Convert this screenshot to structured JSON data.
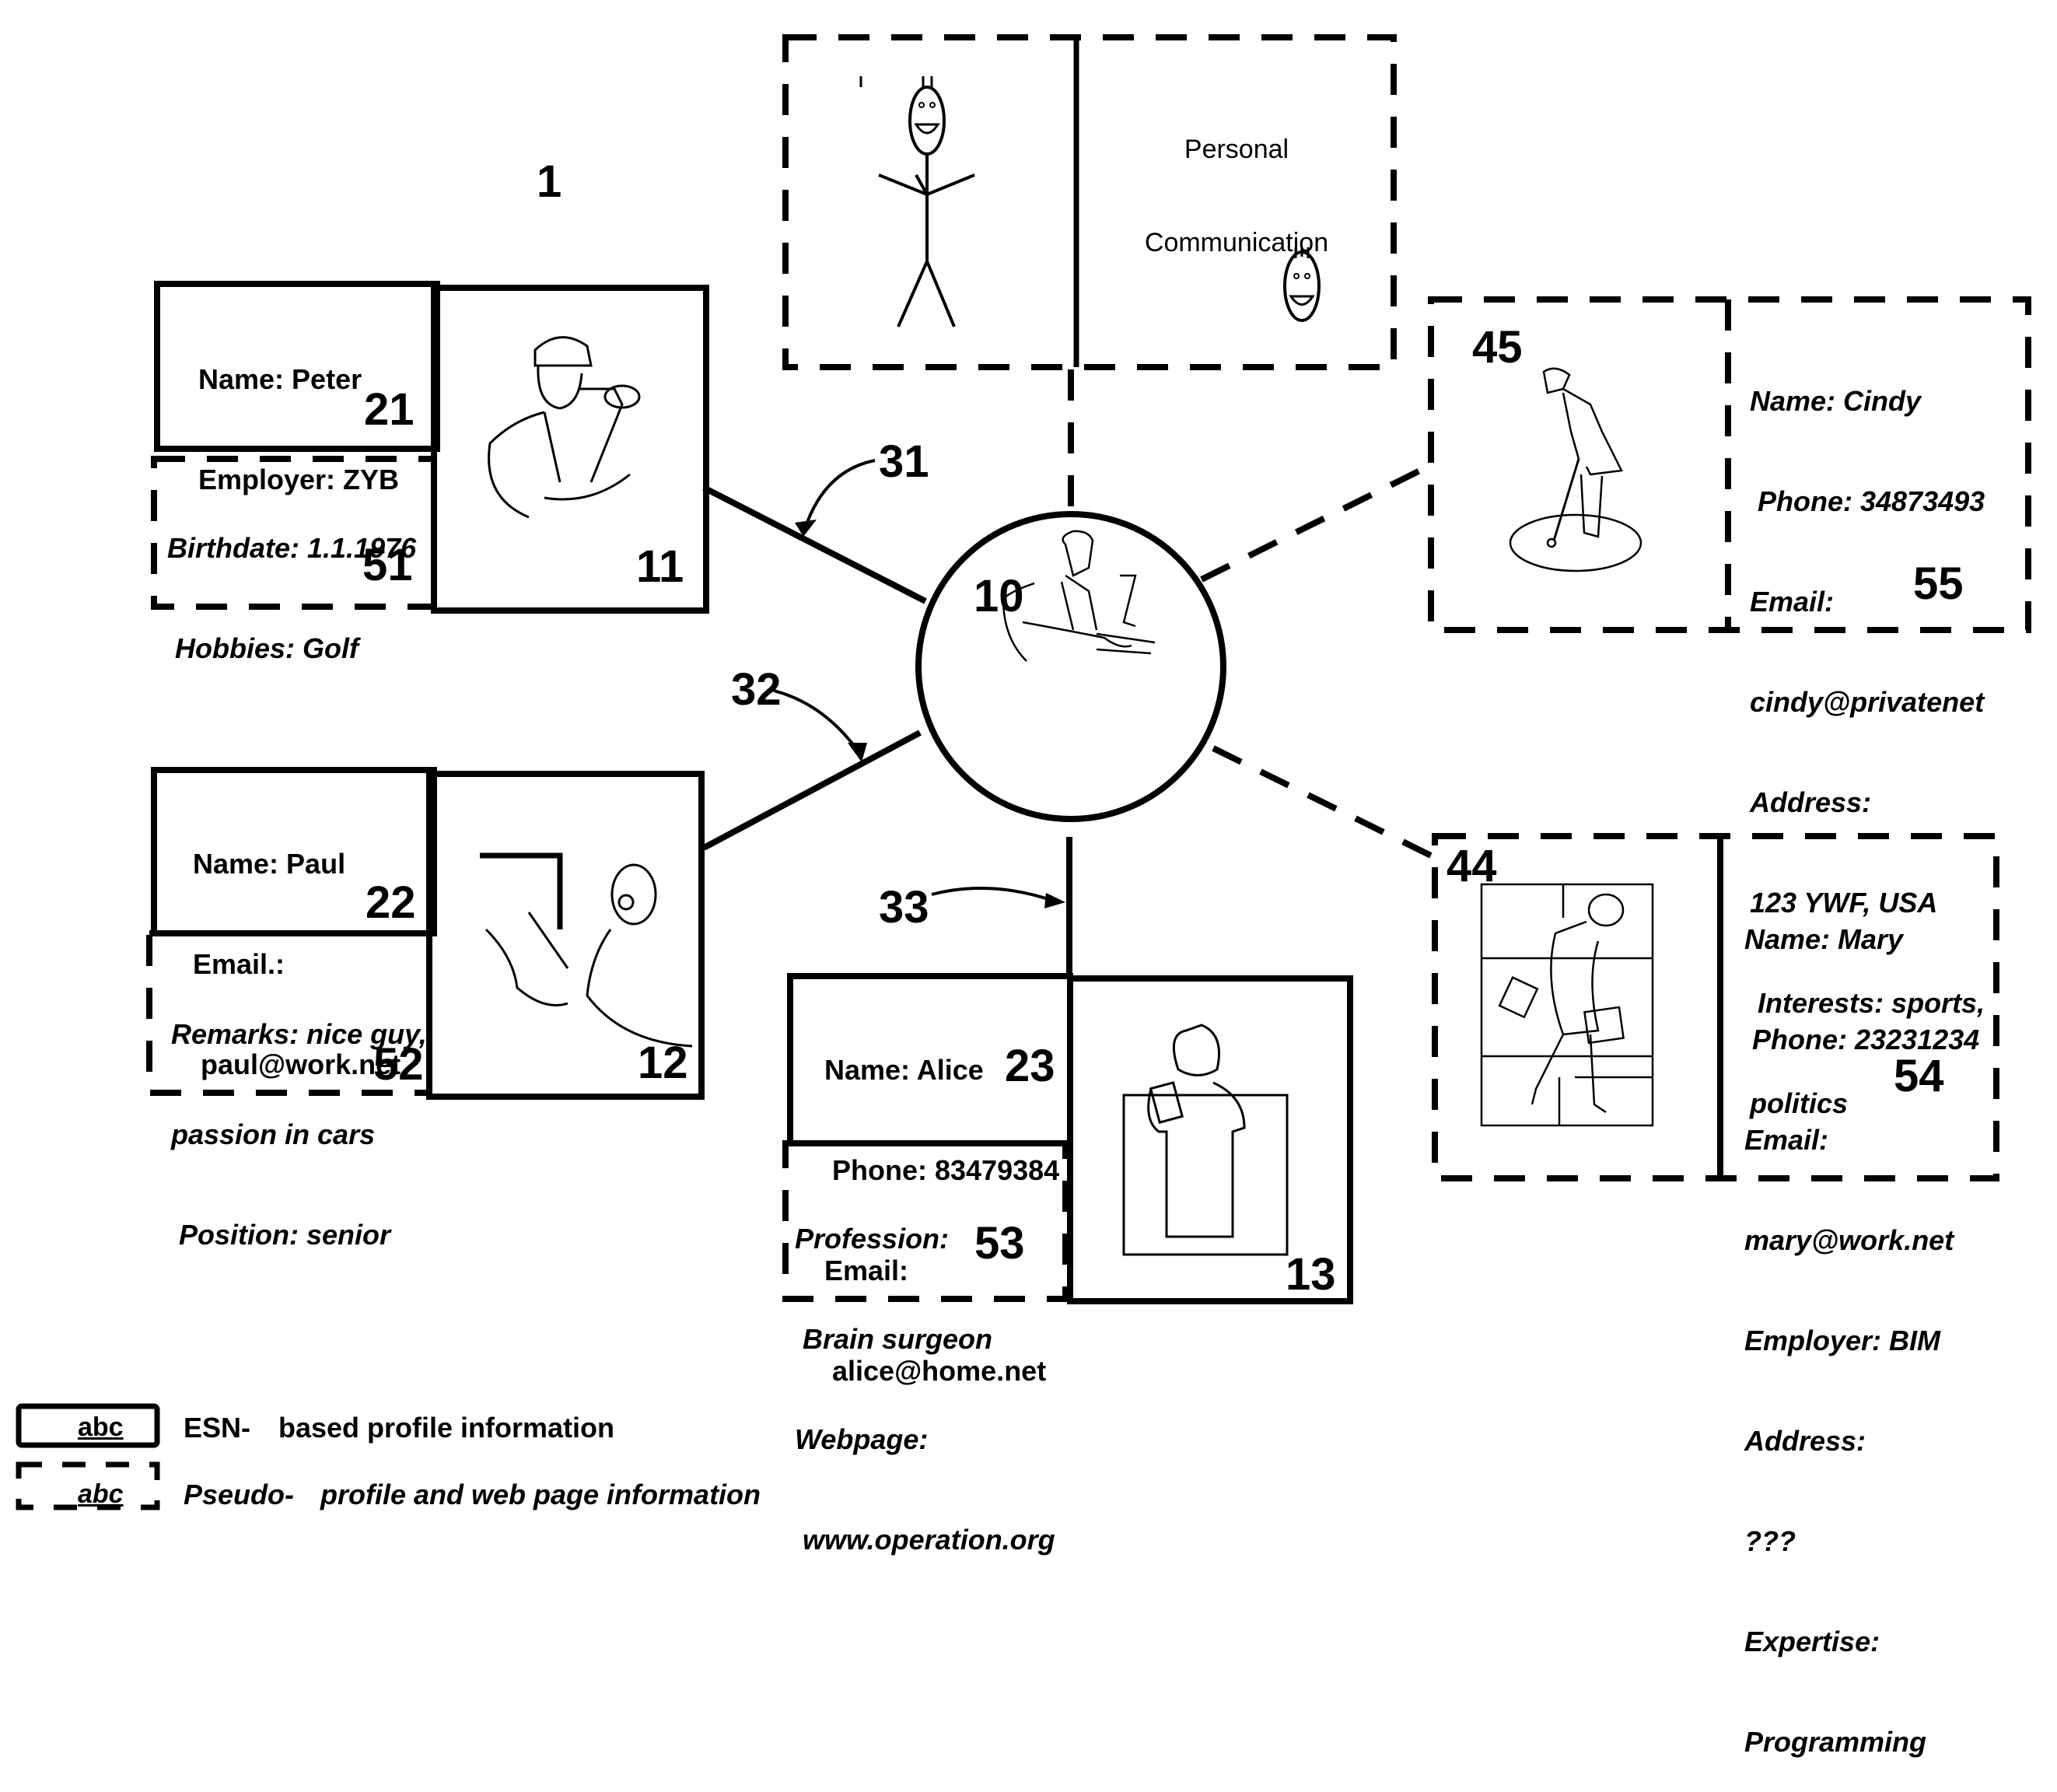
{
  "figure": {
    "figure_ref": "1",
    "center_node": {
      "ref": "10",
      "icon": "person-at-computer-icon"
    },
    "connectors": [
      {
        "ref": "31",
        "to": "11",
        "style": "solid"
      },
      {
        "ref": "32",
        "to": "12",
        "style": "solid"
      },
      {
        "ref": "33",
        "to": "13",
        "style": "solid"
      }
    ],
    "personal_communication": {
      "label_line1": "Personal",
      "label_line2": "Communication",
      "icons": [
        "stick-figure-icon",
        "smiley-face-icon"
      ]
    },
    "contacts": [
      {
        "image_ref": "11",
        "image_icon": "woman-with-hardhat-blueprints-icon",
        "esn": {
          "ref": "21",
          "lines": [
            "Name: Peter",
            "Employer: ZYB"
          ]
        },
        "pseudo": {
          "ref": "51",
          "lines": [
            "Birthdate: 1.1.1976",
            " Hobbies: Golf"
          ]
        }
      },
      {
        "image_ref": "12",
        "image_icon": "presenter-with-pointer-icon",
        "esn": {
          "ref": "22",
          "lines": [
            "Name: Paul",
            "Email.:",
            " paul@work.net"
          ]
        },
        "pseudo": {
          "ref": "52",
          "lines": [
            "Remarks: nice guy,",
            "passion in cars",
            " Position: senior"
          ]
        }
      },
      {
        "image_ref": "13",
        "image_icon": "doctor-with-clipboard-icon",
        "esn": {
          "ref": "23",
          "lines": [
            "Name: Alice",
            " Phone: 83479384",
            "Email:",
            " alice@home.net"
          ]
        },
        "pseudo": {
          "ref": "53",
          "lines": [
            "Profession:",
            " Brain surgeon",
            "Webpage:",
            " www.operation.org"
          ]
        }
      },
      {
        "image_ref": "45",
        "image_icon": "woman-golfer-icon",
        "pseudo": {
          "ref": "55",
          "lines": [
            "Name: Cindy",
            " Phone: 34873493",
            "Email:",
            "cindy@privatenet",
            "Address:",
            "123 YWF, USA",
            " Interests: sports,",
            "politics"
          ]
        }
      },
      {
        "image_ref": "44",
        "image_icon": "businesswoman-with-briefcase-icon",
        "pseudo": {
          "ref": "54",
          "lines": [
            "Name: Mary",
            " Phone: 23231234",
            "Email:",
            "mary@work.net",
            "Employer: BIM",
            "Address:",
            "???",
            "Expertise:",
            "Programming"
          ]
        }
      }
    ]
  },
  "legend": {
    "items": [
      {
        "sample": "abc",
        "style": "solid",
        "prefix": "ESN-",
        "text": "based profile information"
      },
      {
        "sample": "abc",
        "style": "dashed",
        "prefix": "Pseudo-",
        "text": "profile and web page information"
      }
    ]
  }
}
